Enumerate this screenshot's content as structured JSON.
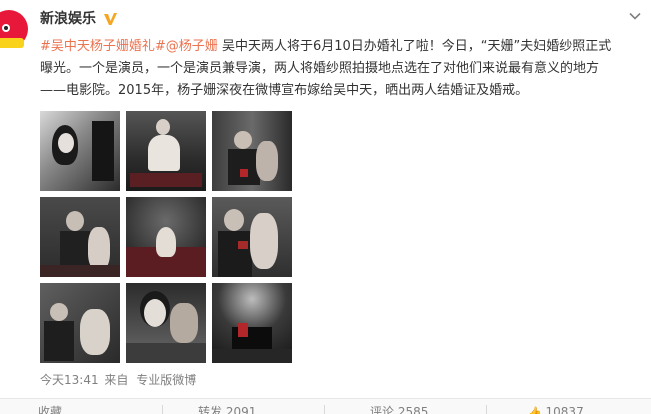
{
  "post": {
    "username": "新浪娱乐",
    "verified_icon": "verified-v-icon",
    "text_hashtag": "#吴中天杨子姗婚礼#",
    "text_mention": "@杨子姗",
    "text_body_1": "吴中天两人将于6月10日办婚礼了啦！今日，“天姗”夫妇婚纱照正式",
    "text_body_2": "曝光。一个是演员，一个是演员兼导演，两人将婚纱照拍摄地点选在了对他们来说最有意义的地方",
    "text_body_3": "——电影院。2015年，杨子姗深夜在微博宣布嫁给吴中天，晒出两人结婚证及婚戒。",
    "timestamp": "今天13:41",
    "source_prefix": "来自",
    "source": "专业版微博"
  },
  "actions": {
    "favorite": "收藏",
    "repost": "转发 2091",
    "comment": "评论 2585",
    "like": "10837"
  },
  "colors": {
    "link": "#eb7350",
    "text": "#333333",
    "meta": "#808080",
    "brand_red": "#e8183a",
    "verify_yellow": "#f5a623"
  }
}
